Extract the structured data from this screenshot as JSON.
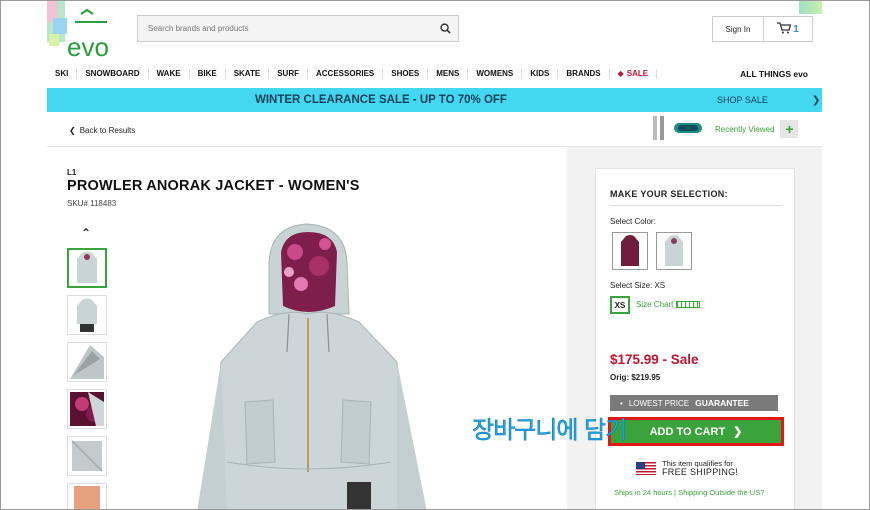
{
  "header": {
    "logo_text": "evo",
    "search_placeholder": "Search brands and products",
    "signin_label": "Sign In",
    "cart_count": "1"
  },
  "nav": {
    "items": [
      "SKI",
      "SNOWBOARD",
      "WAKE",
      "BIKE",
      "SKATE",
      "SURF",
      "ACCESSORIES",
      "SHOES",
      "MENS",
      "WOMENS",
      "KIDS",
      "BRANDS"
    ],
    "sale_label": "SALE",
    "allthings_label": "ALL THINGS evo"
  },
  "banner": {
    "promo": "WINTER CLEARANCE SALE - UP TO 70% OFF",
    "shop_sale": "SHOP SALE"
  },
  "subbar": {
    "back_label": "Back to Results",
    "recently_viewed": "Recently Viewed"
  },
  "product": {
    "brand": "L1",
    "title": "PROWLER ANORAK JACKET - WOMEN'S",
    "sku": "SKU# 118483"
  },
  "selection": {
    "heading": "MAKE YOUR SELECTION:",
    "color_label": "Select Color:",
    "size_label": "Select Size: XS",
    "size_value": "XS",
    "size_chart": "Size Chart"
  },
  "pricing": {
    "sale_price": "$175.99 - Sale",
    "orig_price": "Orig: $219.95",
    "guarantee_prefix": "LOWEST PRICE",
    "guarantee_bold": "GUARANTEE"
  },
  "cart": {
    "add_label": "ADD TO CART"
  },
  "shipping": {
    "line1": "This item qualifies for",
    "line2": "FREE SHIPPING!",
    "links": "Ships in 24 hours | Shipping Outside the US?"
  },
  "annotation": {
    "text": "장바구니에 담기"
  },
  "colors": {
    "accent_green": "#3aa33c",
    "sale_red": "#c0142f",
    "banner_cyan": "#44d8f0",
    "highlight_red": "#e01818",
    "annotation_blue": "#22a8e8"
  }
}
